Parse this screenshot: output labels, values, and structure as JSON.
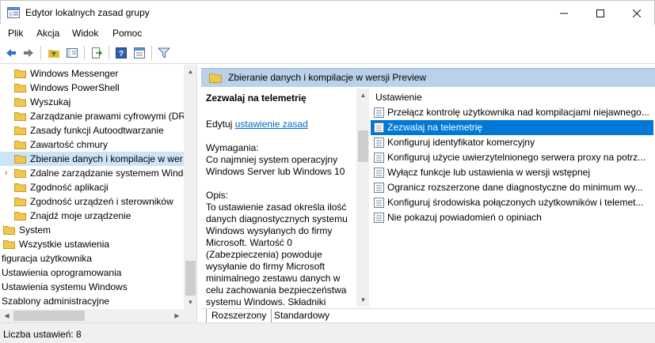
{
  "window": {
    "title": "Edytor lokalnych zasad grupy"
  },
  "menu": [
    "Plik",
    "Akcja",
    "Widok",
    "Pomoc"
  ],
  "tree": {
    "items": [
      {
        "label": "Windows Messenger",
        "type": "folder"
      },
      {
        "label": "Windows PowerShell",
        "type": "folder"
      },
      {
        "label": "Wyszukaj",
        "type": "folder"
      },
      {
        "label": "Zarządzanie prawami cyfrowymi (DR",
        "type": "folder"
      },
      {
        "label": "Zasady funkcji Autoodtwarzanie",
        "type": "folder"
      },
      {
        "label": "Zawartość chmury",
        "type": "folder"
      },
      {
        "label": "Zbieranie danych i kompilacje w wer",
        "type": "folder",
        "selected": true
      },
      {
        "label": "Zdalne zarządzanie systemem Windo",
        "type": "folder",
        "expandable": true
      },
      {
        "label": "Zgodność aplikacji",
        "type": "folder"
      },
      {
        "label": "Zgodność urządzeń i sterowników",
        "type": "folder"
      },
      {
        "label": "Znajdź moje urządzenie",
        "type": "folder"
      },
      {
        "label": "System",
        "type": "folder-root"
      },
      {
        "label": "Wszystkie ustawienia",
        "type": "folder-all"
      },
      {
        "label": "figuracja użytkownika",
        "type": "plain"
      },
      {
        "label": "Ustawienia oprogramowania",
        "type": "plain"
      },
      {
        "label": "Ustawienia systemu Windows",
        "type": "plain"
      },
      {
        "label": "Szablony administracyjne",
        "type": "plain"
      }
    ]
  },
  "right": {
    "header_title": "Zbieranie danych i kompilacje w wersji Preview",
    "description": {
      "title": "Zezwalaj na telemetrię",
      "edit_prefix": "Edytuj",
      "edit_link": "ustawienie zasad",
      "requirements_label": "Wymagania:",
      "requirements_text": "Co najmniej system operacyjny Windows Server lub Windows 10",
      "opis_label": "Opis:",
      "opis_lines": [
        "To ustawienie zasad określa ilość",
        "danych diagnostycznych systemu",
        "Windows wysyłanych do firmy",
        "Microsoft. Wartość 0",
        "(Zabezpieczenia) powoduje",
        "wysyłanie do firmy Microsoft",
        "minimalnego zestawu danych w",
        "celu zachowania bezpieczeństwa",
        "systemu Windows. Składniki"
      ]
    },
    "list": {
      "column_header": "Ustawienie",
      "rows": [
        {
          "label": "Przełącz kontrolę użytkownika nad kompilacjami niejawnego..."
        },
        {
          "label": "Zezwalaj na telemetrię",
          "selected": true
        },
        {
          "label": "Konfiguruj identyfikator komercyjny"
        },
        {
          "label": "Konfiguruj użycie uwierzytelnionego serwera proxy na potrz..."
        },
        {
          "label": "Wyłącz funkcje lub ustawienia w wersji wstępnej"
        },
        {
          "label": "Ogranicz rozszerzone dane diagnostyczne do minimum wy..."
        },
        {
          "label": "Konfiguruj środowiska połączonych użytkowników i telemet..."
        },
        {
          "label": "Nie pokazuj powiadomień o opiniach"
        }
      ]
    },
    "tabs": [
      "Rozszerzony",
      "Standardowy"
    ]
  },
  "status": {
    "text": "Liczba ustawień: 8"
  },
  "colors": {
    "selection_blue": "#0078d7",
    "header_band": "#b9d1ea",
    "folder_yellow": "#f0c850"
  }
}
